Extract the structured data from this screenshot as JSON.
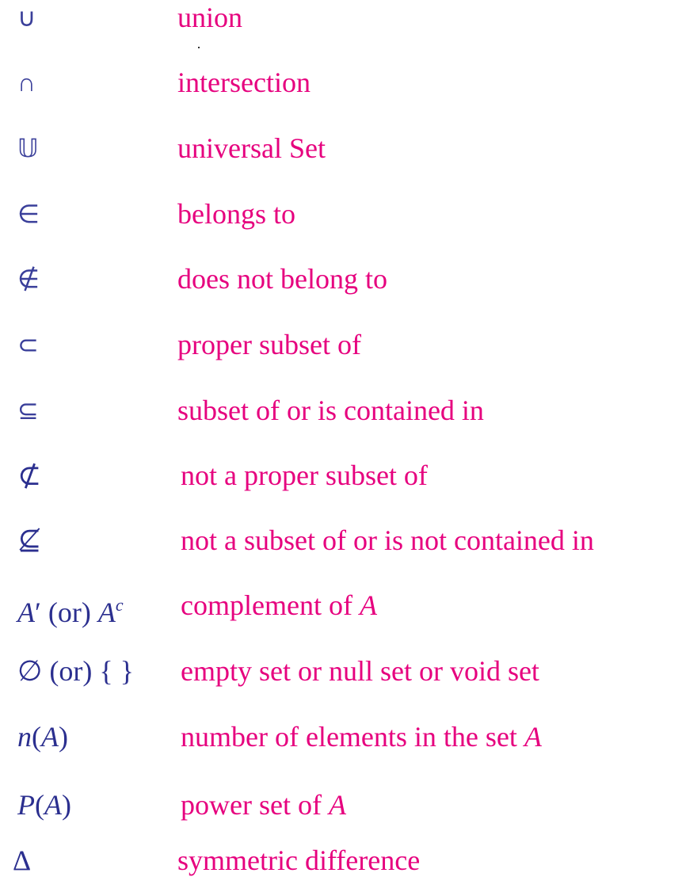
{
  "colors": {
    "symbol": "#2B2F8F",
    "meaning": "#E6007E"
  },
  "rows": [
    {
      "symbol": "∪",
      "meaning": "union"
    },
    {
      "symbol": "∩",
      "meaning": "intersection"
    },
    {
      "symbol": "𝕌",
      "meaning": "universal Set"
    },
    {
      "symbol": "∈",
      "meaning": "belongs to"
    },
    {
      "symbol": "∉",
      "meaning": "does not belong to"
    },
    {
      "symbol": "⊂",
      "meaning": "proper subset of"
    },
    {
      "symbol": "⊆",
      "meaning": "subset of  or  is contained in"
    },
    {
      "symbol": "⊄",
      "meaning": "not a proper subset of"
    },
    {
      "symbol": "⊈",
      "meaning": "not a subset of  or  is not contained in"
    },
    {
      "symbol_parts": {
        "a": "A",
        "prime": "′",
        "or": " (or) ",
        "b": "A",
        "sup": "c"
      },
      "meaning": "complement of ",
      "meaning_var": "A"
    },
    {
      "symbol": "∅ (or) {  }",
      "meaning": "empty set or null set or void set"
    },
    {
      "symbol_parts": {
        "fn": "n",
        "open": "(",
        "var": "A",
        "close": ")"
      },
      "meaning": "number of elements in the set ",
      "meaning_var": "A"
    },
    {
      "symbol_parts": {
        "fn": "P",
        "open": "(",
        "var": "A",
        "close": ")"
      },
      "meaning": "power set of ",
      "meaning_var": "A"
    },
    {
      "symbol": "Δ",
      "meaning": "symmetric difference"
    }
  ]
}
